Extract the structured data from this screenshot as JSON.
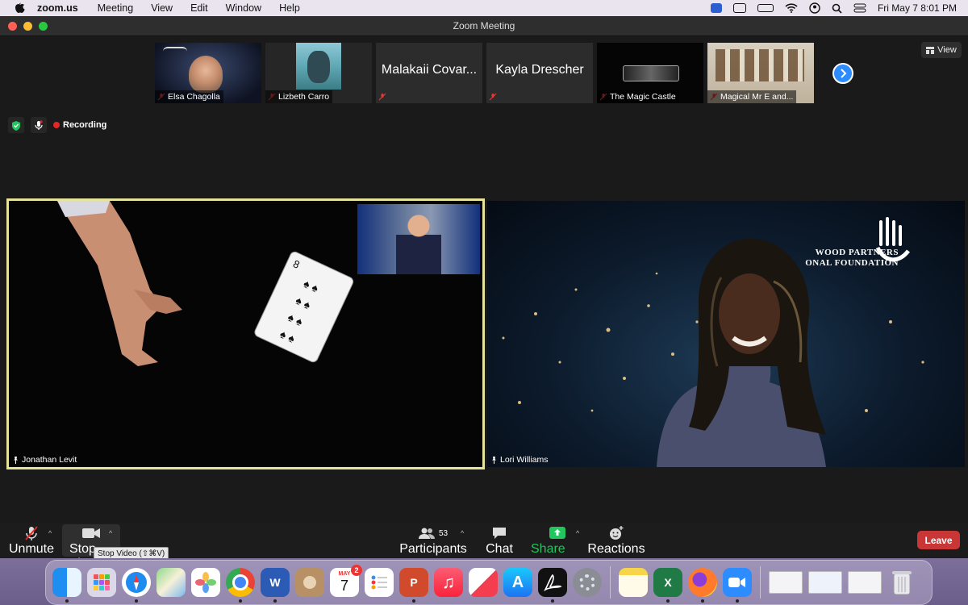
{
  "menubar": {
    "app_name": "zoom.us",
    "items": [
      "Meeting",
      "View",
      "Edit",
      "Window",
      "Help"
    ],
    "clock": "Fri May 7  8:01 PM"
  },
  "window": {
    "title": "Zoom Meeting"
  },
  "thumbnails": [
    {
      "name": "Elsa Chagolla",
      "mode": "video"
    },
    {
      "name": "Lizbeth Carro",
      "mode": "video"
    },
    {
      "name": "Malakaii Covar...",
      "display": "Malakaii Covar...",
      "mode": "text"
    },
    {
      "name": "Kayla Drescher",
      "display": "Kayla Drescher",
      "mode": "text"
    },
    {
      "name": "The Magic Castle",
      "mode": "video"
    },
    {
      "name": "Magical Mr E and...",
      "mode": "video"
    }
  ],
  "view_button": {
    "label": "View"
  },
  "status": {
    "recording": "Recording"
  },
  "video_left": {
    "name": "Jonathan Levit"
  },
  "video_right": {
    "name": "Lori Williams",
    "overlay_line1": "WOOD PARTNERS",
    "overlay_line2": "ONAL FOUNDATION"
  },
  "toolbar": {
    "unmute": "Unmute",
    "stop_video": "Stop Vi",
    "stop_video_tooltip": "Stop Video (⇧⌘V)",
    "participants": "Participants",
    "participants_count": "53",
    "chat": "Chat",
    "share_screen": "Share Screen",
    "reactions": "Reactions",
    "leave": "Leave"
  },
  "dock": {
    "calendar_month": "MAY",
    "calendar_day": "7",
    "calendar_badge": "2",
    "apps": [
      "finder",
      "launchpad",
      "safari",
      "maps",
      "photos",
      "chrome",
      "word",
      "contacts",
      "calendar",
      "reminders",
      "powerpoint",
      "music",
      "news",
      "app-store",
      "acrobat",
      "system-preferences",
      "notes",
      "excel",
      "firefox",
      "zoom",
      "window-1",
      "window-2",
      "window-3",
      "trash"
    ]
  },
  "colors": {
    "accent": "#2d8cff",
    "leave": "#c93636",
    "share": "#22c55e",
    "active_border": "#e6e39a",
    "recording": "#e02828"
  }
}
